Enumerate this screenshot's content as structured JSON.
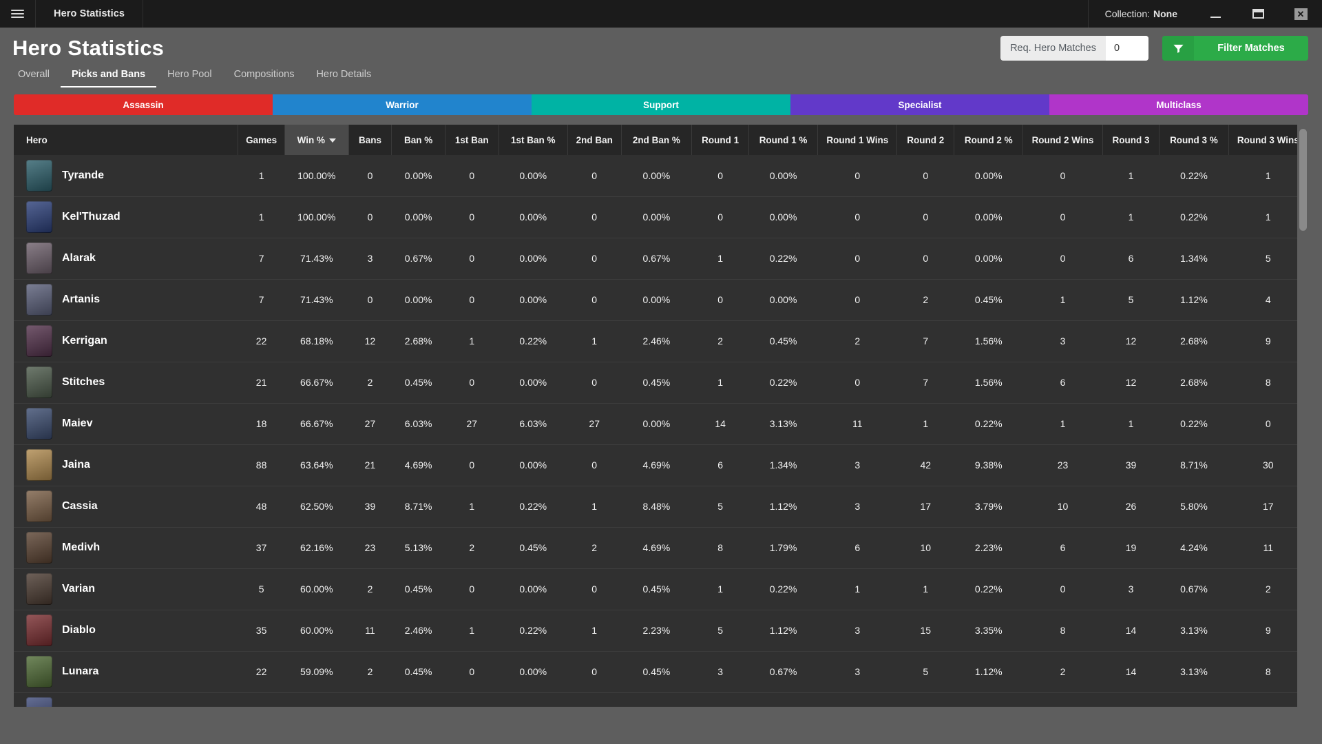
{
  "titlebar": {
    "app_title": "Hero Statistics",
    "collection_label": "Collection:",
    "collection_value": "None",
    "menu_icon": "hamburger-icon",
    "minimize_icon": "minimize-icon",
    "maximize_icon": "maximize-icon",
    "close_icon": "close-icon"
  },
  "header": {
    "page_title": "Hero Statistics",
    "tabs": [
      {
        "label": "Overall",
        "active": false
      },
      {
        "label": "Picks and Bans",
        "active": true
      },
      {
        "label": "Hero Pool",
        "active": false
      },
      {
        "label": "Compositions",
        "active": false
      },
      {
        "label": "Hero Details",
        "active": false
      }
    ]
  },
  "filters": {
    "req_hero_matches_label": "Req. Hero Matches",
    "req_hero_matches_value": "0",
    "req_hero_matches_placeholder": "0",
    "filter_button_label": "Filter Matches",
    "filter_icon": "funnel-icon",
    "filter_button_color": "#2cab48"
  },
  "roles": [
    {
      "label": "Assassin",
      "color": "#e02b28"
    },
    {
      "label": "Warrior",
      "color": "#2184cd"
    },
    {
      "label": "Support",
      "color": "#00b3a4"
    },
    {
      "label": "Specialist",
      "color": "#6239c9"
    },
    {
      "label": "Multiclass",
      "color": "#b035c9"
    }
  ],
  "table": {
    "sort_column": "Win %",
    "sort_direction": "desc",
    "columns": [
      "Hero",
      "Games",
      "Win %",
      "Bans",
      "Ban %",
      "1st Ban",
      "1st Ban %",
      "2nd Ban",
      "2nd Ban %",
      "Round 1",
      "Round 1 %",
      "Round 1 Wins",
      "Round 2",
      "Round 2 %",
      "Round 2 Wins",
      "Round 3",
      "Round 3 %",
      "Round 3 Wins"
    ],
    "rows": [
      {
        "hero": "Tyrande",
        "portrait": "#2c5f6b",
        "cells": [
          "1",
          "100.00%",
          "0",
          "0.00%",
          "0",
          "0.00%",
          "0",
          "0.00%",
          "0",
          "0.00%",
          "0",
          "0",
          "0.00%",
          "0",
          "1",
          "0.22%",
          "1"
        ]
      },
      {
        "hero": "Kel'Thuzad",
        "portrait": "#2b3f7a",
        "cells": [
          "1",
          "100.00%",
          "0",
          "0.00%",
          "0",
          "0.00%",
          "0",
          "0.00%",
          "0",
          "0.00%",
          "0",
          "0",
          "0.00%",
          "0",
          "1",
          "0.22%",
          "1"
        ]
      },
      {
        "hero": "Alarak",
        "portrait": "#6d5f6b",
        "cells": [
          "7",
          "71.43%",
          "3",
          "0.67%",
          "0",
          "0.00%",
          "0",
          "0.67%",
          "1",
          "0.22%",
          "0",
          "0",
          "0.00%",
          "0",
          "6",
          "1.34%",
          "5"
        ]
      },
      {
        "hero": "Artanis",
        "portrait": "#5a5f7a",
        "cells": [
          "7",
          "71.43%",
          "0",
          "0.00%",
          "0",
          "0.00%",
          "0",
          "0.00%",
          "0",
          "0.00%",
          "0",
          "2",
          "0.45%",
          "1",
          "5",
          "1.12%",
          "4"
        ]
      },
      {
        "hero": "Kerrigan",
        "portrait": "#52304a",
        "cells": [
          "22",
          "68.18%",
          "12",
          "2.68%",
          "1",
          "0.22%",
          "1",
          "2.46%",
          "2",
          "0.45%",
          "2",
          "7",
          "1.56%",
          "3",
          "12",
          "2.68%",
          "9"
        ]
      },
      {
        "hero": "Stitches",
        "portrait": "#4c5a4a",
        "cells": [
          "21",
          "66.67%",
          "2",
          "0.45%",
          "0",
          "0.00%",
          "0",
          "0.45%",
          "1",
          "0.22%",
          "0",
          "7",
          "1.56%",
          "6",
          "12",
          "2.68%",
          "8"
        ]
      },
      {
        "hero": "Maiev",
        "portrait": "#3b4c70",
        "cells": [
          "18",
          "66.67%",
          "27",
          "6.03%",
          "27",
          "6.03%",
          "27",
          "0.00%",
          "14",
          "3.13%",
          "11",
          "1",
          "0.22%",
          "1",
          "1",
          "0.22%",
          "0"
        ]
      },
      {
        "hero": "Jaina",
        "portrait": "#b08a4e",
        "cells": [
          "88",
          "63.64%",
          "21",
          "4.69%",
          "0",
          "0.00%",
          "0",
          "4.69%",
          "6",
          "1.34%",
          "3",
          "42",
          "9.38%",
          "23",
          "39",
          "8.71%",
          "30"
        ]
      },
      {
        "hero": "Cassia",
        "portrait": "#7a5e45",
        "cells": [
          "48",
          "62.50%",
          "39",
          "8.71%",
          "1",
          "0.22%",
          "1",
          "8.48%",
          "5",
          "1.12%",
          "3",
          "17",
          "3.79%",
          "10",
          "26",
          "5.80%",
          "17"
        ]
      },
      {
        "hero": "Medivh",
        "portrait": "#5a4231",
        "cells": [
          "37",
          "62.16%",
          "23",
          "5.13%",
          "2",
          "0.45%",
          "2",
          "4.69%",
          "8",
          "1.79%",
          "6",
          "10",
          "2.23%",
          "6",
          "19",
          "4.24%",
          "11"
        ]
      },
      {
        "hero": "Varian",
        "portrait": "#4a3a30",
        "cells": [
          "5",
          "60.00%",
          "2",
          "0.45%",
          "0",
          "0.00%",
          "0",
          "0.45%",
          "1",
          "0.22%",
          "1",
          "1",
          "0.22%",
          "0",
          "3",
          "0.67%",
          "2"
        ]
      },
      {
        "hero": "Diablo",
        "portrait": "#7a2d30",
        "cells": [
          "35",
          "60.00%",
          "11",
          "2.46%",
          "1",
          "0.22%",
          "1",
          "2.23%",
          "5",
          "1.12%",
          "3",
          "15",
          "3.35%",
          "8",
          "14",
          "3.13%",
          "9"
        ]
      },
      {
        "hero": "Lunara",
        "portrait": "#4f6b35",
        "cells": [
          "22",
          "59.09%",
          "2",
          "0.45%",
          "0",
          "0.00%",
          "0",
          "0.45%",
          "3",
          "0.67%",
          "3",
          "5",
          "1.12%",
          "2",
          "14",
          "3.13%",
          "8"
        ]
      },
      {
        "hero": "",
        "portrait": "#3f4b7a",
        "cells": [
          "",
          "",
          "",
          "",
          "",
          "",
          "",
          "",
          "",
          "",
          "",
          "",
          "",
          "",
          "",
          "",
          ""
        ]
      }
    ]
  }
}
